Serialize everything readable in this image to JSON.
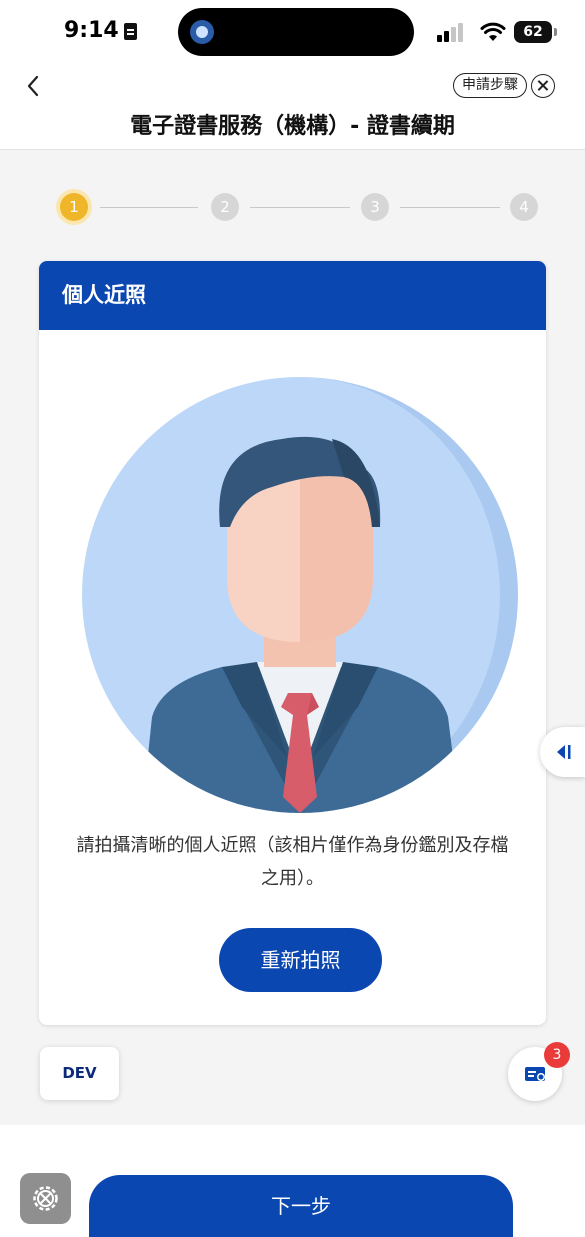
{
  "status_bar": {
    "time": "9:14",
    "battery": "62"
  },
  "header": {
    "apply_steps_label": "申請步驟",
    "title": "電子證書服務（機構）- 證書續期"
  },
  "stepper": {
    "steps": [
      "1",
      "2",
      "3",
      "4"
    ],
    "current": 1
  },
  "card": {
    "title": "個人近照",
    "instruction": "請拍攝清晰的個人近照（該相片僅作為身份鑑別及存檔之用）。",
    "retake_label": "重新拍照"
  },
  "floating": {
    "dev_label": "DEV",
    "message_count": "3"
  },
  "footer": {
    "next_label": "下一步"
  },
  "colors": {
    "primary": "#0b47b0",
    "step_active": "#f0b62a",
    "badge": "#ea3b3b"
  }
}
